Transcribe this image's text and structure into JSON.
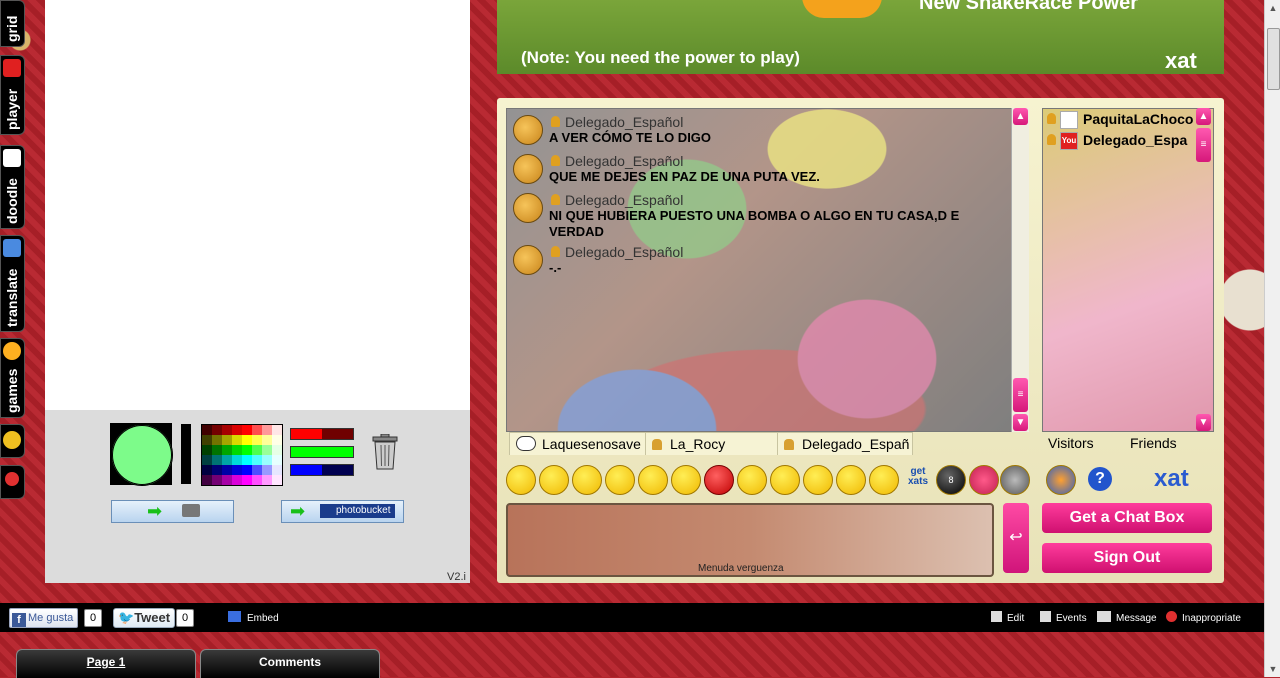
{
  "app_tabs": [
    {
      "label": "grid"
    },
    {
      "label": "player"
    },
    {
      "label": "doodle"
    },
    {
      "label": "translate"
    },
    {
      "label": "games"
    }
  ],
  "banner": {
    "title": "New SnakeRace Power",
    "note": "(Note: You need the power to play)",
    "logo": "xat"
  },
  "doodle": {
    "version": "V2.i",
    "current_color": "#7dfb8a",
    "photobucket_label": "photobucket"
  },
  "messages": [
    {
      "user": "Delegado_Español",
      "text": "A VER CÓMO TE LO DIGO"
    },
    {
      "user": "Delegado_Español",
      "text": "QUE ME DEJES EN PAZ DE UNA PUTA VEZ."
    },
    {
      "user": "Delegado_Español",
      "text": "NI QUE HUBIERA PUESTO UNA BOMBA O ALGO EN TU CASA,D E VERDAD"
    },
    {
      "user": "Delegado_Español",
      "text": "-.-"
    }
  ],
  "users": [
    {
      "name": "PaquitaLaChoco"
    },
    {
      "name": "Delegado_Espa"
    }
  ],
  "pc_tabs": [
    {
      "label": "Laquesenosave"
    },
    {
      "label": "La_Rocy"
    },
    {
      "label": "Delegado_Españ"
    }
  ],
  "list_tabs": {
    "visitors": "Visitors",
    "friends": "Friends"
  },
  "smileys_extra": {
    "getxats": "get xats",
    "ball": "8",
    "help": "?",
    "logo": "xat"
  },
  "input": {
    "value": "",
    "caption": "Menuda verguenza"
  },
  "buttons": {
    "send": "↩",
    "get_chat_box": "Get a Chat Box",
    "sign_out": "Sign Out"
  },
  "bottom": {
    "like": "Me gusta",
    "like_count": "0",
    "tweet": "Tweet",
    "tweet_count": "0",
    "embed": "Embed",
    "actions": [
      "Edit",
      "Events",
      "Message",
      "Inappropriate"
    ]
  },
  "page_tabs": [
    {
      "label": "Page 1",
      "active": true
    },
    {
      "label": "Comments",
      "active": false
    }
  ]
}
